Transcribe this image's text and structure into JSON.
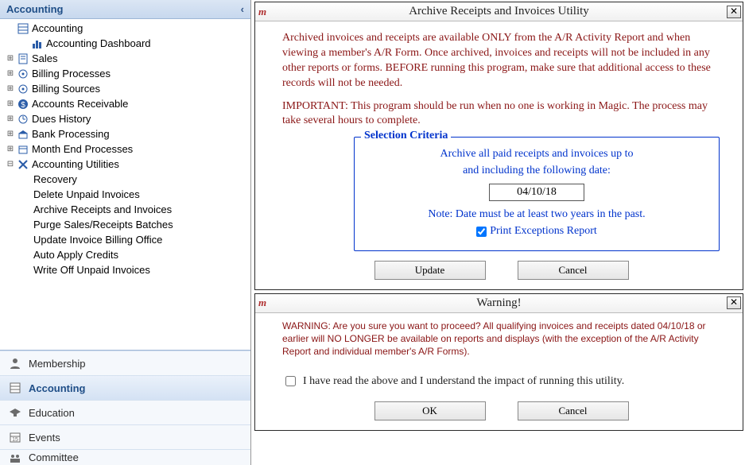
{
  "sidebar": {
    "title": "Accounting",
    "tree": {
      "root": {
        "label": "Accounting"
      },
      "dashboard": {
        "label": "Accounting Dashboard"
      },
      "sales": {
        "label": "Sales"
      },
      "billing_processes": {
        "label": "Billing Processes"
      },
      "billing_sources": {
        "label": "Billing Sources"
      },
      "ar": {
        "label": "Accounts Receivable"
      },
      "dues_history": {
        "label": "Dues History"
      },
      "bank_processing": {
        "label": "Bank Processing"
      },
      "month_end": {
        "label": "Month End Processes"
      },
      "utilities": {
        "label": "Accounting Utilities"
      },
      "util_items": [
        {
          "label": "Recovery"
        },
        {
          "label": "Delete Unpaid Invoices"
        },
        {
          "label": "Archive Receipts and Invoices"
        },
        {
          "label": "Purge Sales/Receipts Batches"
        },
        {
          "label": "Update Invoice Billing Office"
        },
        {
          "label": "Auto Apply Credits"
        },
        {
          "label": "Write Off Unpaid Invoices"
        }
      ]
    },
    "modules": [
      {
        "label": "Membership"
      },
      {
        "label": "Accounting"
      },
      {
        "label": "Education"
      },
      {
        "label": "Events"
      },
      {
        "label": "Committee"
      }
    ]
  },
  "archive": {
    "title": "Archive Receipts and Invoices Utility",
    "para1": "Archived invoices and receipts are available ONLY from the A/R Activity Report and when viewing a member's A/R Form. Once archived, invoices and receipts will not be included in any other reports or forms. BEFORE running this program, make sure that additional access to these records will not be needed.",
    "para2": "IMPORTANT: This program should be run when no one is working in Magic. The process may take several hours to complete.",
    "group_title": "Selection Criteria",
    "line1": "Archive all paid receipts and invoices up to",
    "line2": "and including the following date:",
    "date_value": "04/10/18",
    "note": "Note: Date must be at least two years in the past.",
    "print_label": "Print Exceptions Report",
    "print_checked": true,
    "update_label": "Update",
    "cancel_label": "Cancel"
  },
  "warning": {
    "title": "Warning!",
    "text": "WARNING: Are you sure you want to proceed? All qualifying invoices and receipts dated 04/10/18 or earlier will NO LONGER be available on reports and displays (with the exception of the A/R Activity Report and individual member's A/R Forms).",
    "confirm_label": "I have read the above and I understand the impact of running this utility.",
    "confirm_checked": false,
    "ok_label": "OK",
    "cancel_label": "Cancel"
  }
}
